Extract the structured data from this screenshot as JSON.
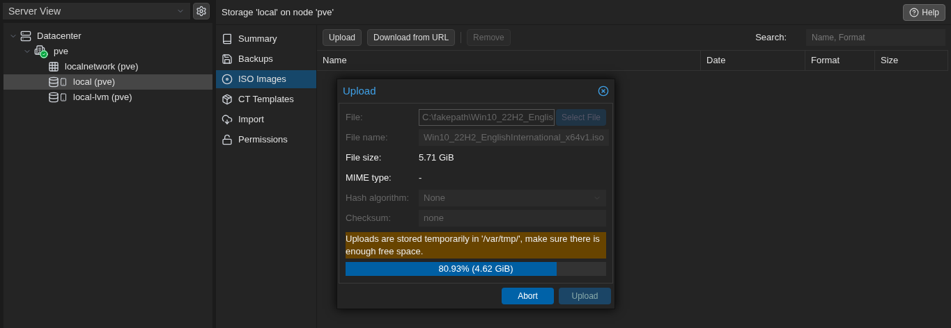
{
  "sidebar": {
    "view_selector": "Server View",
    "tree": [
      {
        "label": "Datacenter",
        "kind": "datacenter",
        "expanded": true,
        "selected": false,
        "children": [
          {
            "label": "pve",
            "kind": "node",
            "expanded": true,
            "selected": false,
            "children": [
              {
                "label": "localnetwork (pve)",
                "kind": "network",
                "selected": false
              },
              {
                "label": "local (pve)",
                "kind": "storage",
                "selected": true
              },
              {
                "label": "local-lvm (pve)",
                "kind": "storage",
                "selected": false
              }
            ]
          }
        ]
      }
    ]
  },
  "header": {
    "title": "Storage 'local' on node 'pve'",
    "help_button": "Help"
  },
  "nav": [
    {
      "label": "Summary",
      "kind": "summary",
      "selected": false
    },
    {
      "label": "Backups",
      "kind": "backups",
      "selected": false
    },
    {
      "label": "ISO Images",
      "kind": "iso",
      "selected": true
    },
    {
      "label": "CT Templates",
      "kind": "templates",
      "selected": false
    },
    {
      "label": "Import",
      "kind": "import",
      "selected": false
    },
    {
      "label": "Permissions",
      "kind": "permissions",
      "selected": false
    }
  ],
  "toolbar": {
    "buttons": [
      {
        "label": "Upload",
        "disabled": false
      },
      {
        "label": "Download from URL",
        "disabled": false
      },
      {
        "label": "Remove",
        "disabled": true
      }
    ],
    "search_label": "Search:",
    "search_placeholder": "Name, Format"
  },
  "table": {
    "columns": [
      "Name",
      "Date",
      "Format",
      "Size"
    ]
  },
  "dialog": {
    "title": "Upload",
    "fields": [
      {
        "label": "File:",
        "kind": "file",
        "value": "C:\\fakepath\\Win10_22H2_Englis",
        "button": "Select File",
        "disabled": true
      },
      {
        "label": "File name:",
        "kind": "input",
        "value": "Win10_22H2_EnglishInternational_x64v1.iso",
        "disabled": true
      },
      {
        "label": "File size:",
        "kind": "text",
        "value": "5.71 GiB"
      },
      {
        "label": "MIME type:",
        "kind": "text",
        "value": "-"
      },
      {
        "label": "Hash algorithm:",
        "kind": "select",
        "value": "None",
        "disabled": true
      },
      {
        "label": "Checksum:",
        "kind": "input",
        "placeholder": "none",
        "disabled": true
      }
    ],
    "warning": "Uploads are stored temporarily in '/var/tmp/', make sure there is enough free space.",
    "progress": {
      "level": 0.8093,
      "text": "80.93% (4.62 GiB)"
    },
    "buttons": [
      {
        "label": "Abort",
        "disabled": false
      },
      {
        "label": "Upload",
        "disabled": true
      }
    ]
  }
}
